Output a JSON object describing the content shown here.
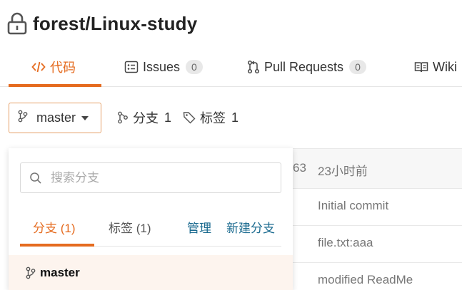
{
  "repo": {
    "title": "forest/Linux-study"
  },
  "tabs": [
    {
      "label": "代码"
    },
    {
      "label": "Issues",
      "count": "0"
    },
    {
      "label": "Pull Requests",
      "count": "0"
    },
    {
      "label": "Wiki"
    }
  ],
  "branch_selector": {
    "current": "master"
  },
  "meta": {
    "branches_label": "分支",
    "branches_count": "1",
    "tags_label": "标签",
    "tags_count": "1"
  },
  "commit_list": {
    "header_hash_fragment": "63",
    "header_time": "23小时前",
    "rows": [
      "Initial commit",
      "file.txt:aaa",
      "modified ReadMe"
    ]
  },
  "dropdown": {
    "search_placeholder": "搜索分支",
    "tab_branches": "分支 (1)",
    "tab_tags": "标签 (1)",
    "manage": "管理",
    "new_branch": "新建分支",
    "branches": [
      "master"
    ]
  },
  "colors": {
    "accent": "#e56b1f",
    "link": "#1a6a8f",
    "selected_bg": "#fdf4ee"
  }
}
